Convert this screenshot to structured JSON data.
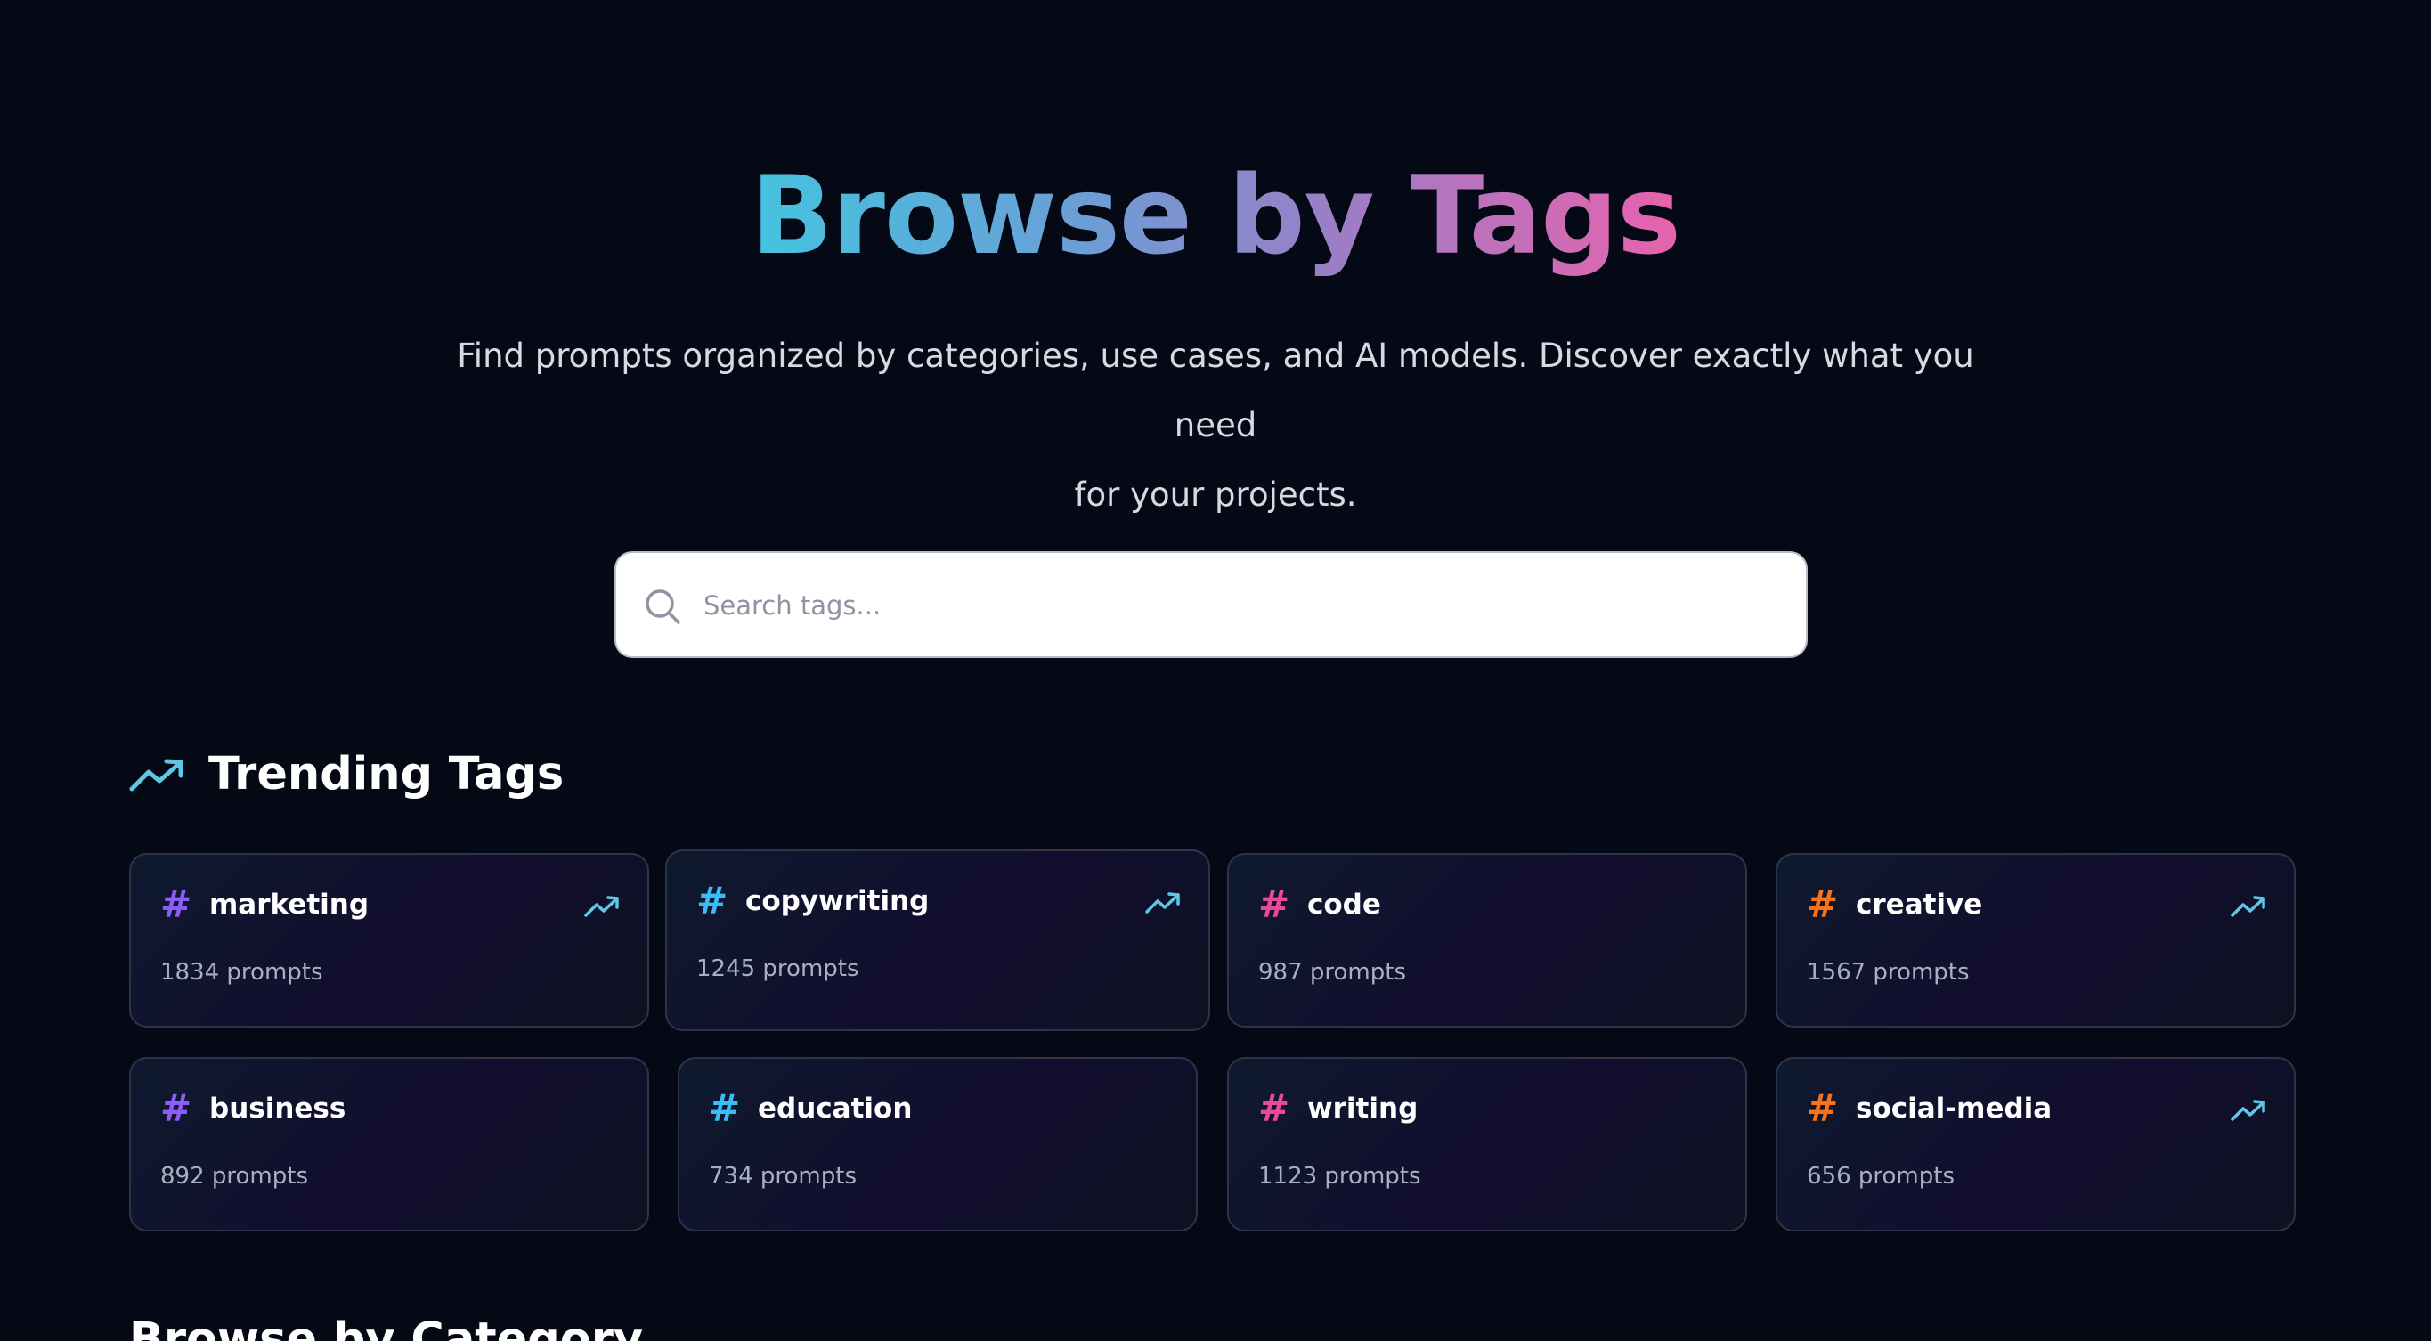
{
  "hero": {
    "title": "Browse by Tags",
    "subtitle_line1": "Find prompts organized by categories, use cases, and AI models. Discover exactly what you need",
    "subtitle_line2": "for your projects."
  },
  "search": {
    "placeholder": "Search tags...",
    "value": "",
    "icon": "search-icon"
  },
  "trending": {
    "title": "Trending Tags",
    "icon": "trending-up-icon",
    "tags": [
      {
        "name": "marketing",
        "count": "1834 prompts",
        "hash_color": "#8b5cf6",
        "trending": true
      },
      {
        "name": "copywriting",
        "count": "1245 prompts",
        "hash_color": "#38bdf8",
        "trending": true
      },
      {
        "name": "code",
        "count": "987 prompts",
        "hash_color": "#ec4899",
        "trending": false
      },
      {
        "name": "creative",
        "count": "1567 prompts",
        "hash_color": "#f97316",
        "trending": true
      },
      {
        "name": "business",
        "count": "892 prompts",
        "hash_color": "#8b5cf6",
        "trending": false
      },
      {
        "name": "education",
        "count": "734 prompts",
        "hash_color": "#38bdf8",
        "trending": false
      },
      {
        "name": "writing",
        "count": "1123 prompts",
        "hash_color": "#ec4899",
        "trending": false
      },
      {
        "name": "social-media",
        "count": "656 prompts",
        "hash_color": "#f97316",
        "trending": true
      }
    ]
  },
  "category": {
    "title": "Browse by Category"
  },
  "colors": {
    "background": "#050915",
    "accent_cyan": "#45c3df",
    "accent_pink": "#e862ad",
    "trend_icon": "#5cc8e6"
  }
}
